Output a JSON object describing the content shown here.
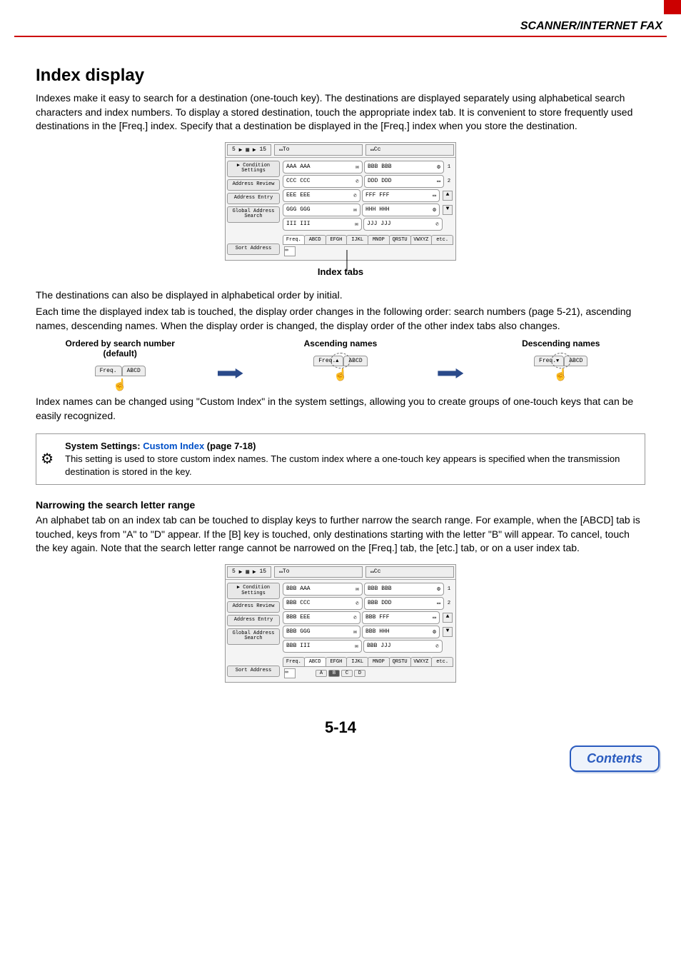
{
  "header": {
    "section": "SCANNER/INTERNET FAX"
  },
  "h1": "Index display",
  "intro": "Indexes make it easy to search for a destination (one-touch key). The destinations are displayed separately using alphabetical search characters and index numbers. To display a stored destination, touch the appropriate index tab. It is convenient to store frequently used destinations in the [Freq.] index. Specify that a destination be displayed in the [Freq.] index when you store the destination.",
  "figure1": {
    "topbar": {
      "count": "5",
      "sep": "▶",
      "pages": "15",
      "to": "To",
      "cc": "Cc"
    },
    "side": [
      "Condition\nSettings",
      "Address Review",
      "Address Entry",
      "Global\nAddress Search",
      "Sort Address"
    ],
    "rows": [
      [
        "AAA AAA",
        "BBB BBB"
      ],
      [
        "CCC CCC",
        "DDD DDD"
      ],
      [
        "EEE EEE",
        "FFF FFF"
      ],
      [
        "GGG GGG",
        "HHH HHH"
      ],
      [
        "III III",
        "JJJ JJJ"
      ]
    ],
    "pageind": [
      "1",
      "2"
    ],
    "tabs": [
      "Freq.",
      "ABCD",
      "EFGH",
      "IJKL",
      "MNOP",
      "QRSTU",
      "VWXYZ",
      "etc."
    ],
    "caption": "Index tabs"
  },
  "para2": "The destinations can also be displayed in alphabetical order by initial.",
  "para3": "Each time the displayed index tab is touched, the display order changes in the following order: search numbers (page 5-21), ascending names, descending names. When the display order is changed, the display order of the other index tabs also changes.",
  "triples": {
    "a": {
      "label": "Ordered by search number (default)",
      "t1": "Freq.",
      "t2": "ABCD",
      "sym": ""
    },
    "b": {
      "label": "Ascending names",
      "t1": "Freq.",
      "t2": "ABCD",
      "sym": "▲"
    },
    "c": {
      "label": "Descending names",
      "t1": "Freq.",
      "t2": "ABCD",
      "sym": "▼"
    }
  },
  "para4": "Index names can be changed using \"Custom Index\" in the system settings, allowing you to create groups of one-touch keys that can be easily recognized.",
  "note": {
    "strong": "System Settings: ",
    "link": "Custom Index",
    "rest": " (page 7-18)",
    "body": "This setting is used to store custom index names. The custom index where a one-touch key appears is specified when the transmission destination is stored in the key."
  },
  "subhead": "Narrowing the search letter range",
  "para5": "An alphabet tab on an index tab can be touched to display keys to further narrow the search range. For example, when the [ABCD] tab is touched, keys from \"A\" to \"D\" appear. If the [B] key is touched, only destinations starting with the letter \"B\" will appear. To cancel, touch the key again. Note that the search letter range cannot be narrowed on the [Freq.] tab, the [etc.] tab, or on a user index tab.",
  "figure2": {
    "rows": [
      [
        "BBB AAA",
        "BBB BBB"
      ],
      [
        "BBB CCC",
        "BBB DDD"
      ],
      [
        "BBB EEE",
        "BBB FFF"
      ],
      [
        "BBB GGG",
        "BBB HHH"
      ],
      [
        "BBB III",
        "BBB JJJ"
      ]
    ],
    "subtabs": [
      "A",
      "B",
      "C",
      "D"
    ],
    "selected_subtab": "B",
    "selected_tab": "ABCD"
  },
  "pagenum": "5-14",
  "contents_btn": "Contents"
}
